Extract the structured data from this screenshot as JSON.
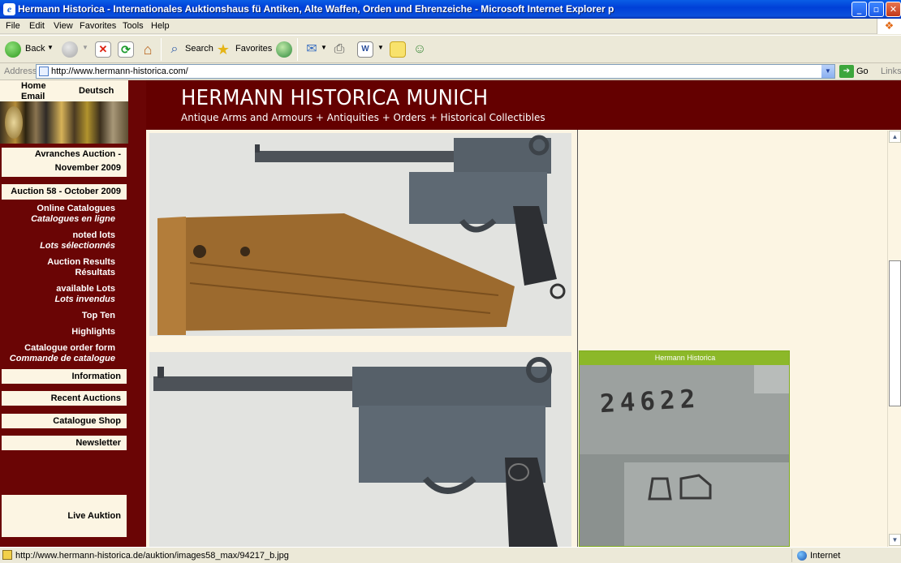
{
  "window": {
    "title": "Hermann Historica - Internationales Auktionshaus fü Antiken, Alte Waffen, Orden und Ehrenzeiche - Microsoft Internet Explorer p"
  },
  "menu": [
    "File",
    "Edit",
    "View",
    "Favorites",
    "Tools",
    "Help"
  ],
  "toolbar": {
    "back": "Back",
    "search": "Search",
    "favorites": "Favorites"
  },
  "address": {
    "label": "Address",
    "url": "http://www.hermann-historica.com/",
    "go": "Go",
    "links": "Links"
  },
  "site": {
    "title": "HERMANN HISTORICA MUNICH",
    "tagline": "Antique Arms and Armours + Antiquities + Orders + Historical Collectibles"
  },
  "topnav": {
    "home": "Home",
    "email": "Email",
    "deutsch": "Deutsch"
  },
  "nav": {
    "avranches_line1": "Avranches Auction -",
    "avranches_line2": "November 2009",
    "auction58": "Auction 58 - October 2009",
    "online_catalogues": "Online Catalogues",
    "catalogues_en_ligne": "Catalogues en ligne",
    "noted_lots": "noted lots",
    "lots_selectionnes": "Lots sélectionnés",
    "auction_results": "Auction Results",
    "resultats": "Résultats",
    "available_lots": "available Lots",
    "lots_invendus": "Lots invendus",
    "top_ten": "Top Ten",
    "highlights": "Highlights",
    "catalogue_order_form": "Catalogue order form",
    "commande_de_catalogue": "Commande de catalogue",
    "information": "Information",
    "recent_auctions": "Recent Auctions",
    "catalogue_shop": "Catalogue Shop",
    "newsletter": "Newsletter",
    "live_auktion": "Live Auktion"
  },
  "detail": {
    "caption": "Hermann Historica",
    "serial": "24622"
  },
  "status": {
    "text": "http://www.hermann-historica.de/auktion/images58_max/94217_b.jpg",
    "zone": "Internet"
  }
}
